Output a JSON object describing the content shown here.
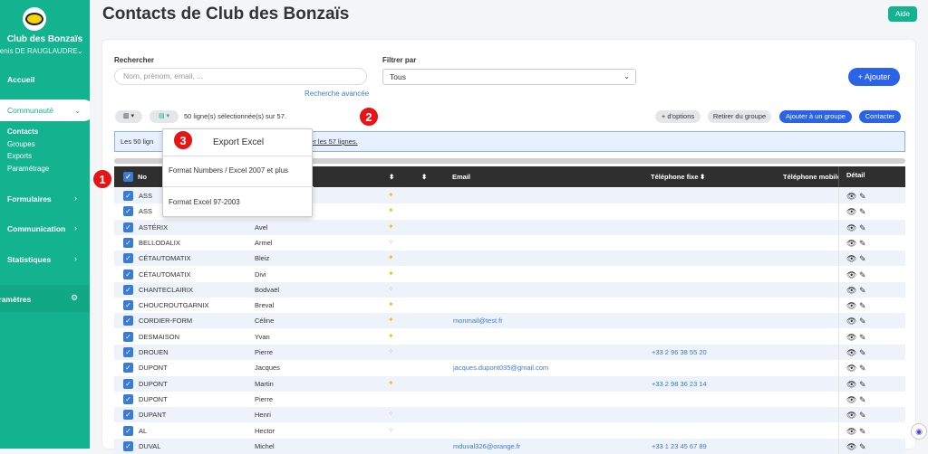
{
  "sidebar": {
    "club_name": "Club des Bonzaïs",
    "user_name": "Denis DE RAUGLAUDRE",
    "items": [
      {
        "label": "Accueil"
      },
      {
        "label": "Communauté"
      },
      {
        "label": "Formulaires"
      },
      {
        "label": "Communication"
      },
      {
        "label": "Statistiques"
      },
      {
        "label": "Paramètres"
      }
    ],
    "sub_items": [
      "Contacts",
      "Groupes",
      "Exports",
      "Paramétrage"
    ]
  },
  "header": {
    "title": "Contacts de Club des Bonzaïs",
    "help": "Aide"
  },
  "search": {
    "label": "Rechercher",
    "placeholder": "Nom, prénom, email, ...",
    "advanced": "Recherche avancée"
  },
  "filter": {
    "label": "Filtrer par",
    "value": "Tous"
  },
  "actions": {
    "add": "+ Ajouter",
    "options": "+ d'options",
    "remove_group": "Retirer du groupe",
    "add_group": "Ajouter à un groupe",
    "contact": "Contacter"
  },
  "selection": {
    "count_text": "50 ligne(s) sélectionnée(s) sur 57.",
    "info_text": "Les 50 lign",
    "info_link": "ner les 57 lignes."
  },
  "export_menu": {
    "title": "Export Excel",
    "option1": "Format Numbers / Excel 2007 et plus",
    "option2": "Format Excel 97-2003"
  },
  "markers": [
    "1",
    "2",
    "3"
  ],
  "table": {
    "headers": {
      "nom": "No",
      "email": "Email",
      "tel": "Téléphone fixe",
      "mobile": "Téléphone mobile",
      "detail": "Détail"
    },
    "rows": [
      {
        "nom": "ASS",
        "prenom": "",
        "star": true,
        "email": "",
        "tel": ""
      },
      {
        "nom": "ASS",
        "prenom": "",
        "star": true,
        "email": "",
        "tel": ""
      },
      {
        "nom": "ASTÉRIX",
        "prenom": "Avel",
        "star": true,
        "email": "",
        "tel": ""
      },
      {
        "nom": "BELLODALIX",
        "prenom": "Armel",
        "star": false,
        "email": "",
        "tel": ""
      },
      {
        "nom": "CÉTAUTOMATIX",
        "prenom": "Bleiz",
        "star": true,
        "email": "",
        "tel": ""
      },
      {
        "nom": "CÉTAUTOMATIX",
        "prenom": "Divi",
        "star": true,
        "email": "",
        "tel": ""
      },
      {
        "nom": "CHANTECLAIRIX",
        "prenom": "Bodvaël",
        "star": false,
        "email": "",
        "tel": ""
      },
      {
        "nom": "CHOUCROUTGARNIX",
        "prenom": "Breval",
        "star": true,
        "email": "",
        "tel": ""
      },
      {
        "nom": "CORDIER-FORM",
        "prenom": "Céline",
        "star": true,
        "email": "monmail@test.fr",
        "tel": ""
      },
      {
        "nom": "DESMAISON",
        "prenom": "Yvan",
        "star": true,
        "email": "",
        "tel": ""
      },
      {
        "nom": "DROUEN",
        "prenom": "Pierre",
        "star": false,
        "email": "",
        "tel": "+33 2 96 38 55 20"
      },
      {
        "nom": "DUPONT",
        "prenom": "Jacques",
        "star": null,
        "email": "jacques.dupont035@gmail.com",
        "tel": ""
      },
      {
        "nom": "DUPONT",
        "prenom": "Martin",
        "star": true,
        "email": "",
        "tel": "+33 2 98 36 23 14"
      },
      {
        "nom": "DUPONT",
        "prenom": "Pierre",
        "star": null,
        "email": "",
        "tel": ""
      },
      {
        "nom": "DUPANT",
        "prenom": "Henri",
        "star": false,
        "email": "",
        "tel": ""
      },
      {
        "nom": "AL",
        "prenom": "Hector",
        "star": false,
        "email": "",
        "tel": ""
      },
      {
        "nom": "DUVAL",
        "prenom": "Michel",
        "star": null,
        "email": "mduval326@orange.fr",
        "tel": "+33 1 23 45 67 89"
      }
    ]
  }
}
